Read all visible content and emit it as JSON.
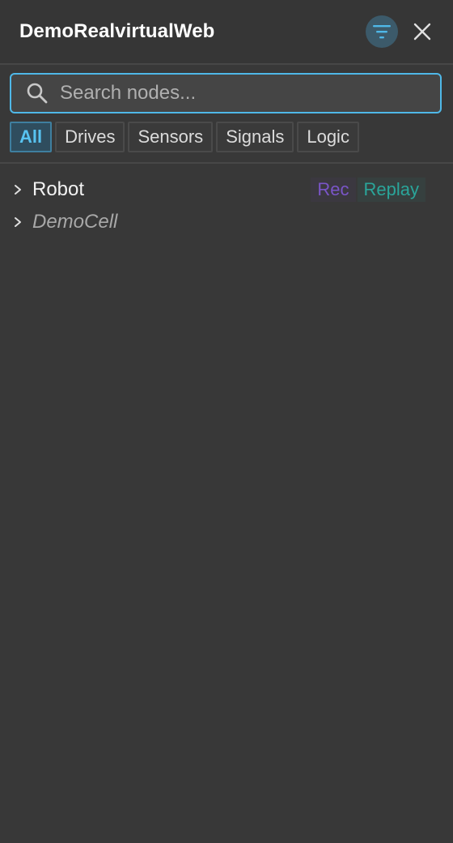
{
  "header": {
    "title": "DemoRealvirtualWeb",
    "filter_icon": "filter-icon",
    "close_icon": "close-icon"
  },
  "search": {
    "placeholder": "Search nodes...",
    "value": ""
  },
  "tabs": [
    {
      "label": "All",
      "active": true
    },
    {
      "label": "Drives",
      "active": false
    },
    {
      "label": "Sensors",
      "active": false
    },
    {
      "label": "Signals",
      "active": false
    },
    {
      "label": "Logic",
      "active": false
    }
  ],
  "tree": [
    {
      "label": "Robot",
      "italic": false,
      "rec": "Rec",
      "replay": "Replay"
    },
    {
      "label": "DemoCell",
      "italic": true
    }
  ],
  "colors": {
    "accent": "#4fb8e8",
    "rec": "#7a55c8",
    "replay": "#2aa59a",
    "background": "#383838"
  }
}
